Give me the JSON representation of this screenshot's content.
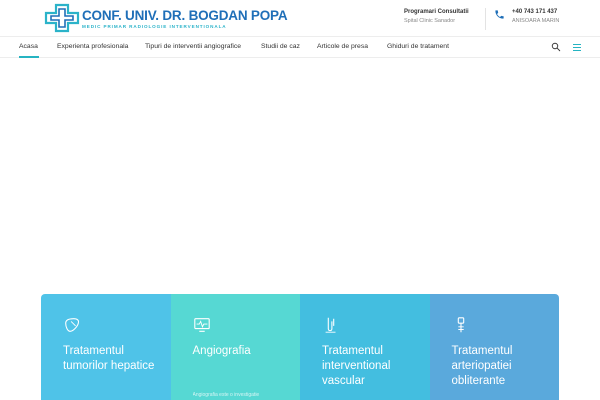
{
  "header": {
    "logo": {
      "title": "CONF. UNIV. DR. BOGDAN POPA",
      "subtitle": "MEDIC PRIMAR RADIOLOGIE INTERVENTIONALA"
    },
    "consultations": {
      "label": "Programari Consultatii",
      "location": "Spital Clinic Sanador"
    },
    "phone": {
      "number": "+40 743 171 437",
      "contact_name": "ANISOARA MARIN"
    }
  },
  "nav": {
    "items": [
      {
        "label": "Acasa",
        "active": true
      },
      {
        "label": "Experienta profesionala"
      },
      {
        "label": "Tipuri de interventii angiografice"
      },
      {
        "label": "Studii de caz"
      },
      {
        "label": "Articole de presa"
      },
      {
        "label": "Ghiduri de tratament"
      }
    ]
  },
  "cards": [
    {
      "title": "Tratamentul tumorilor hepatice",
      "text": "",
      "icon": "liver-icon",
      "color": "#4fc3e8"
    },
    {
      "title": "Angiografia",
      "text": "Angiografia este o investigatie",
      "icon": "monitor-icon",
      "color": "#56d8d3"
    },
    {
      "title": "Tratamentul interventional vascular",
      "text": "",
      "icon": "vessel-icon",
      "color": "#43bee0"
    },
    {
      "title": "Tratamentul arteriopatiei obliterante",
      "text": "",
      "icon": "stent-icon",
      "color": "#5aa9dc"
    }
  ],
  "colors": {
    "brand_blue": "#1f6fb8",
    "accent_teal": "#26b4c2"
  }
}
